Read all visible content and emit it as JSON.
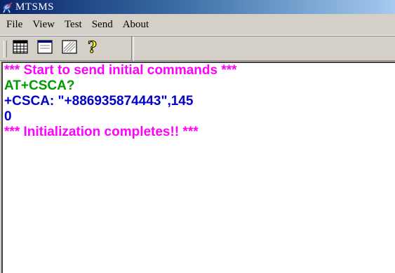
{
  "window": {
    "title": "MTSMS",
    "app_icon": "satellite-dish-icon"
  },
  "menu": {
    "items": [
      "File",
      "View",
      "Test",
      "Send",
      "About"
    ]
  },
  "toolbar": {
    "buttons": [
      "grid-table-icon",
      "window-icon",
      "striped-window-icon",
      "help-question-icon"
    ]
  },
  "console": {
    "lines": [
      {
        "text": "*** Start to send initial commands ***",
        "color": "#ff00ff"
      },
      {
        "text": "AT+CSCA?",
        "color": "#009900"
      },
      {
        "text": "+CSCA: \"+886935874443\",145",
        "color": "#0000cc"
      },
      {
        "text": "0",
        "color": "#0000cc"
      },
      {
        "text": "*** Initialization completes!! ***",
        "color": "#ff00ff"
      }
    ]
  }
}
